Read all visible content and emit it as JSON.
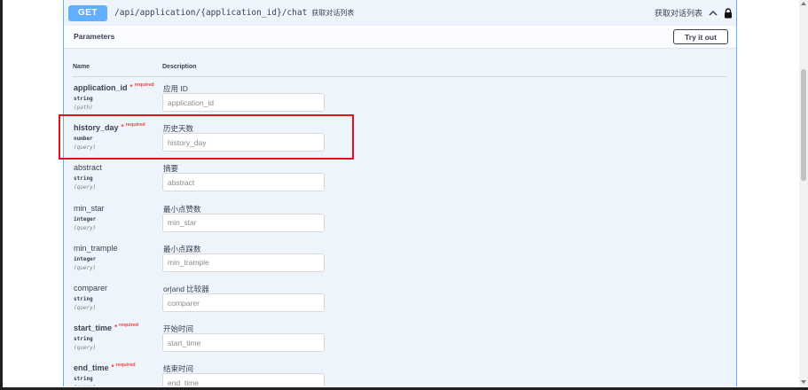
{
  "operation": {
    "method": "GET",
    "path": "/api/application/{application_id}/chat",
    "description": "获取对话列表",
    "right_label": "获取对话列表"
  },
  "parameters": {
    "title": "Parameters",
    "try_button": "Try it out",
    "col_name": "Name",
    "col_description": "Description",
    "items": [
      {
        "name": "application_id",
        "required": true,
        "star": "*",
        "required_label": "required",
        "type": "string",
        "in": "(path)",
        "description": "应用 ID",
        "placeholder": "application_id"
      },
      {
        "name": "history_day",
        "required": true,
        "star": "*",
        "required_label": "required",
        "type": "number",
        "in": "(query)",
        "description": "历史天数",
        "placeholder": "history_day"
      },
      {
        "name": "abstract",
        "required": false,
        "star": "",
        "required_label": "",
        "type": "string",
        "in": "(query)",
        "description": "摘要",
        "placeholder": "abstract"
      },
      {
        "name": "min_star",
        "required": false,
        "star": "",
        "required_label": "",
        "type": "integer",
        "in": "(query)",
        "description": "最小点赞数",
        "placeholder": "min_star"
      },
      {
        "name": "min_trample",
        "required": false,
        "star": "",
        "required_label": "",
        "type": "integer",
        "in": "(query)",
        "description": "最小点踩数",
        "placeholder": "min_trample"
      },
      {
        "name": "comparer",
        "required": false,
        "star": "",
        "required_label": "",
        "type": "string",
        "in": "(query)",
        "description": "or|and 比较器",
        "placeholder": "comparer"
      },
      {
        "name": "start_time",
        "required": true,
        "star": "*",
        "required_label": "required",
        "type": "string",
        "in": "(query)",
        "description": "开始时间",
        "placeholder": "start_time"
      },
      {
        "name": "end_time",
        "required": true,
        "star": "*",
        "required_label": "required",
        "type": "string",
        "in": "(query)",
        "description": "结束时间",
        "placeholder": "end_time"
      }
    ]
  },
  "icons": {
    "collapse": "chevron-up-icon",
    "lock": "lock-icon"
  },
  "colors": {
    "get": "#61affe",
    "required": "#f93e3e",
    "highlight": "#e0141e"
  }
}
